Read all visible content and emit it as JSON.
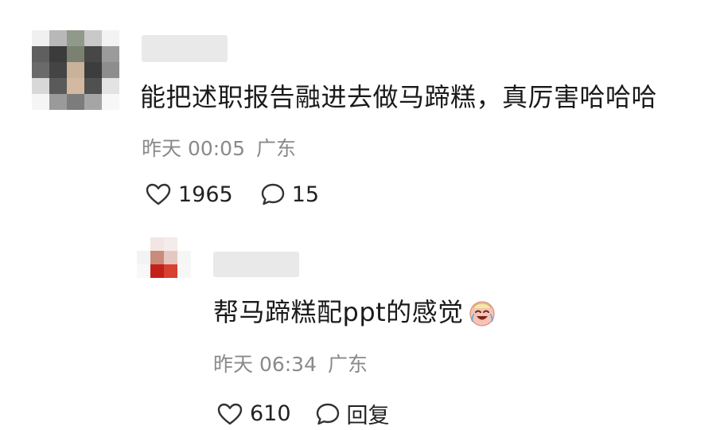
{
  "comment": {
    "text": "能把述职报告融进去做马蹄糕，真厉害哈哈哈",
    "time": "昨天 00:05",
    "location": "广东",
    "like_count": "1965",
    "reply_count": "15"
  },
  "reply": {
    "text": "帮马蹄糕配ppt的感觉",
    "emoji": "crying-laughing-emoji",
    "time": "昨天 06:34",
    "location": "广东",
    "like_count": "610",
    "reply_label": "回复"
  },
  "colors": {
    "text": "#1a1a1a",
    "meta": "#8a8a8a",
    "name_blur": "#e9e9e9"
  },
  "icons": {
    "like": "heart-outline-icon",
    "comment": "speech-bubble-icon"
  }
}
